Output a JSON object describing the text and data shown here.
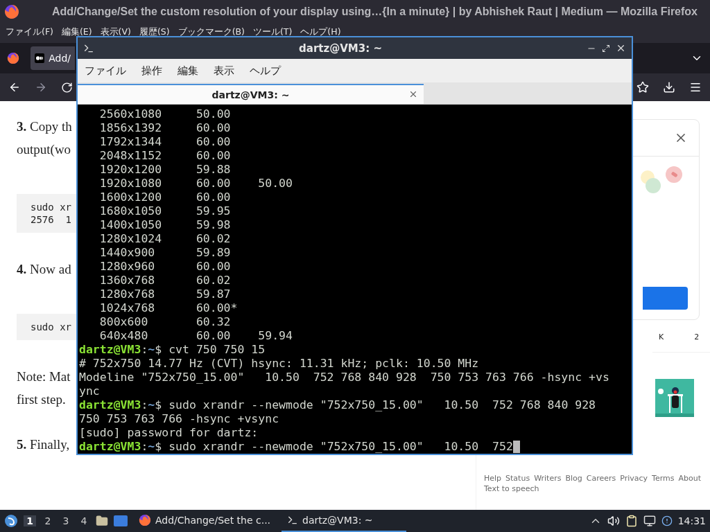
{
  "browser": {
    "title": "Add/Change/Set the custom resolution of your display using…{In a minute} | by Abhishek Raut | Medium — Mozilla Firefox",
    "menu": [
      "ファイル(F)",
      "編集(E)",
      "表示(V)",
      "履歴(S)",
      "ブックマーク(B)",
      "ツール(T)",
      "ヘルプ(H)"
    ],
    "tab": {
      "label": "Add/",
      "selected": true
    }
  },
  "article": {
    "blocks": [
      {
        "kind": "para",
        "lines": [
          "**3.** Copy th",
          "output(wo"
        ]
      },
      {
        "kind": "code",
        "lines": [
          "sudo xr",
          "2576  1"
        ]
      },
      {
        "kind": "para",
        "lines": [
          "**4.** Now ad"
        ]
      },
      {
        "kind": "code",
        "lines": [
          "sudo xr"
        ]
      },
      {
        "kind": "para",
        "lines": [
          "Note: Mat",
          "first step."
        ]
      },
      {
        "kind": "para",
        "lines": [
          "**5.** Finally,"
        ]
      }
    ]
  },
  "sidebar": {
    "fragments": [
      "K",
      "2"
    ],
    "footer_links": [
      "Help",
      "Status",
      "Writers",
      "Blog",
      "Careers",
      "Privacy",
      "Terms",
      "About"
    ],
    "footer_extra": "Text to speech"
  },
  "terminal": {
    "title": "dartz@VM3: ~",
    "menu": [
      "ファイル",
      "操作",
      "編集",
      "表示",
      "ヘルプ"
    ],
    "tab": {
      "label": "dartz@VM3: ~",
      "selected": true
    },
    "lines": [
      {
        "kind": "output",
        "text": "   2560x1080     50.00"
      },
      {
        "kind": "output",
        "text": "   1856x1392     60.00"
      },
      {
        "kind": "output",
        "text": "   1792x1344     60.00"
      },
      {
        "kind": "output",
        "text": "   2048x1152     60.00"
      },
      {
        "kind": "output",
        "text": "   1920x1200     59.88"
      },
      {
        "kind": "output",
        "text": "   1920x1080     60.00    50.00"
      },
      {
        "kind": "output",
        "text": "   1600x1200     60.00"
      },
      {
        "kind": "output",
        "text": "   1680x1050     59.95"
      },
      {
        "kind": "output",
        "text": "   1400x1050     59.98"
      },
      {
        "kind": "output",
        "text": "   1280x1024     60.02"
      },
      {
        "kind": "output",
        "text": "   1440x900      59.89"
      },
      {
        "kind": "output",
        "text": "   1280x960      60.00"
      },
      {
        "kind": "output",
        "text": "   1360x768      60.02"
      },
      {
        "kind": "output",
        "text": "   1280x768      59.87"
      },
      {
        "kind": "output",
        "text": "   1024x768      60.00*"
      },
      {
        "kind": "output",
        "text": "   800x600       60.32"
      },
      {
        "kind": "output",
        "text": "   640x480       60.00    59.94"
      },
      {
        "kind": "prompt",
        "user": "dartz@VM3",
        "separator": ":",
        "path": "~",
        "symbol": "$",
        "command": " cvt 750 750 15",
        "cursor": false
      },
      {
        "kind": "output",
        "text": "# 752x750 14.77 Hz (CVT) hsync: 11.31 kHz; pclk: 10.50 MHz"
      },
      {
        "kind": "output",
        "text": "Modeline \"752x750_15.00\"   10.50  752 768 840 928  750 753 763 766 -hsync +vs"
      },
      {
        "kind": "output",
        "text": "ync"
      },
      {
        "kind": "prompt",
        "user": "dartz@VM3",
        "separator": ":",
        "path": "~",
        "symbol": "$",
        "command": " sudo xrandr --newmode \"752x750_15.00\"   10.50  752 768 840 928",
        "cursor": false
      },
      {
        "kind": "output",
        "text": "750 753 763 766 -hsync +vsync"
      },
      {
        "kind": "output",
        "text": "[sudo] password for dartz:"
      },
      {
        "kind": "prompt",
        "user": "dartz@VM3",
        "separator": ":",
        "path": "~",
        "symbol": "$",
        "command": " sudo xrandr --newmode \"752x750_15.00\"   10.50  752",
        "cursor": true
      }
    ]
  },
  "taskbar": {
    "workspaces": [
      {
        "label": "1",
        "selected": true
      },
      {
        "label": "2",
        "selected": false
      },
      {
        "label": "3",
        "selected": false
      },
      {
        "label": "4",
        "selected": false
      }
    ],
    "tasks": [
      {
        "kind": "firefox",
        "label": "Add/Change/Set the c...",
        "selected": false
      },
      {
        "kind": "terminal",
        "label": "dartz@VM3: ~",
        "selected": true
      }
    ],
    "clock": "14:31"
  }
}
